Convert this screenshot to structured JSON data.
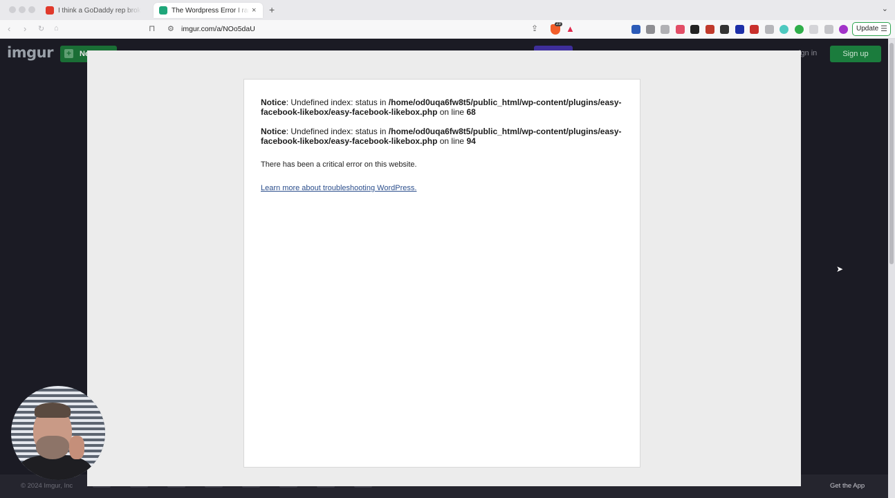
{
  "browser": {
    "tabs": [
      {
        "title": "I think a GoDaddy rep broke my w",
        "active": false,
        "favicon_color": "#e0392b"
      },
      {
        "title": "The Wordpress Error I ran into",
        "active": true,
        "favicon_color": "#1fa67a"
      }
    ],
    "new_tab_symbol": "+",
    "close_symbol": "×",
    "url": "imgur.com/a/NOo5daU",
    "brave_badge": "23",
    "update_label": "Update"
  },
  "imgur": {
    "logo": "imgur",
    "new_post_label": "Ne",
    "sign_in_label": "ign in",
    "sign_up_label": "Sign up",
    "footer_copyright": "© 2024 Imgur, Inc",
    "get_app_label": "Get the App"
  },
  "error_page": {
    "notices": [
      {
        "label": "Notice",
        "message": ": Undefined index: status in ",
        "path": "/home/od0uqa6fw8t5/public_html/wp-content/plugins/easy-facebook-likebox/easy-facebook-likebox.php",
        "on_line": " on line ",
        "line": "68"
      },
      {
        "label": "Notice",
        "message": ": Undefined index: status in ",
        "path": "/home/od0uqa6fw8t5/public_html/wp-content/plugins/easy-facebook-likebox/easy-facebook-likebox.php",
        "on_line": " on line ",
        "line": "94"
      }
    ],
    "critical_message": "There has been a critical error on this website.",
    "learn_more_link": "Learn more about troubleshooting WordPress."
  }
}
